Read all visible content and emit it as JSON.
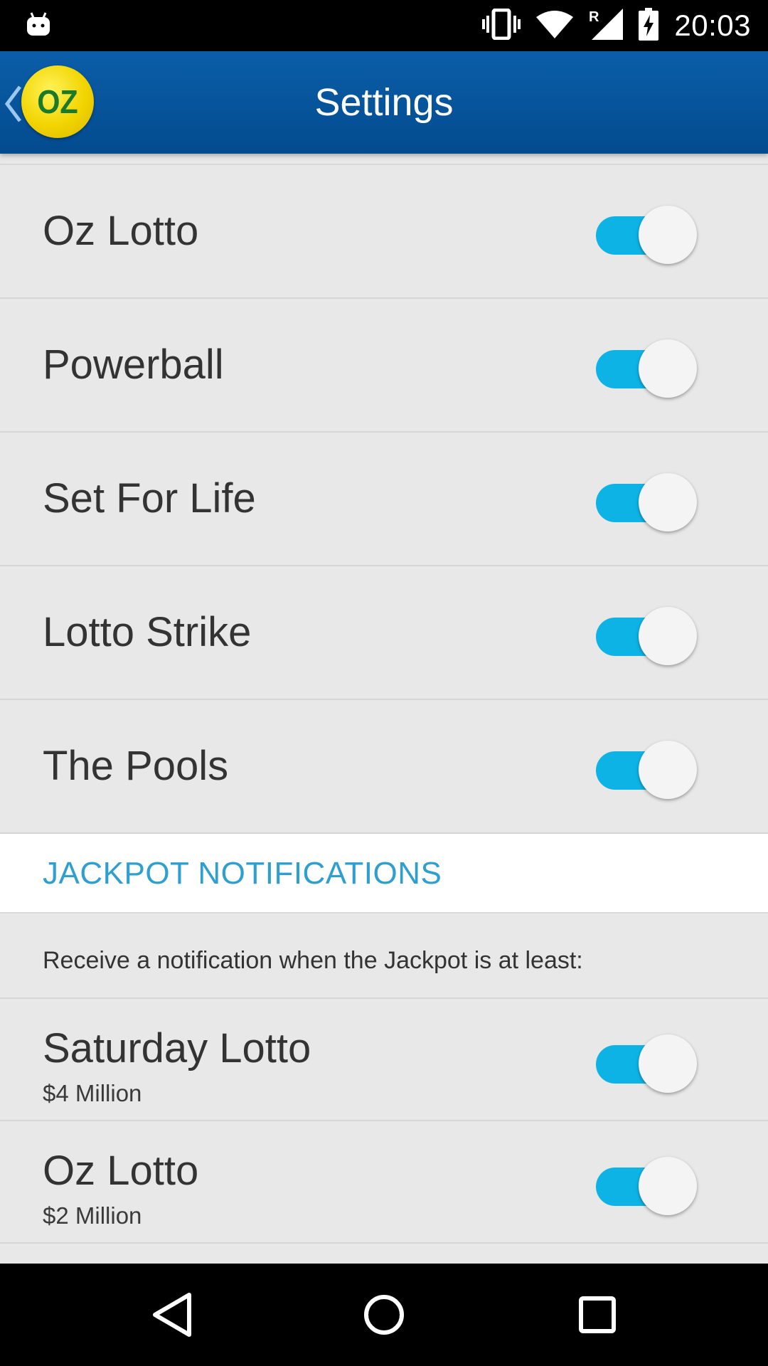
{
  "status_bar": {
    "time": "20:03",
    "notification_icon": "android-icon",
    "icons": [
      "vibrate-icon",
      "wifi-icon",
      "signal-roaming-icon",
      "battery-charging-icon"
    ]
  },
  "app_bar": {
    "logo_text": "OZ",
    "title": "Settings"
  },
  "game_toggles": [
    {
      "label": "Oz Lotto",
      "enabled": true
    },
    {
      "label": "Powerball",
      "enabled": true
    },
    {
      "label": "Set For Life",
      "enabled": true
    },
    {
      "label": "Lotto Strike",
      "enabled": true
    },
    {
      "label": "The Pools",
      "enabled": true
    }
  ],
  "jackpot_section": {
    "header": "JACKPOT NOTIFICATIONS",
    "description": "Receive a notification when the Jackpot is at least:",
    "items": [
      {
        "label": "Saturday Lotto",
        "amount": "$4 Million",
        "enabled": true
      },
      {
        "label": "Oz Lotto",
        "amount": "$2 Million",
        "enabled": true
      }
    ]
  },
  "colors": {
    "app_bar": "#0a5ea8",
    "toggle_on": "#0eb3e6",
    "section_header_text": "#2e9fcf",
    "logo": "#f2d400"
  },
  "nav_bar": {
    "icons": [
      "back-triangle-icon",
      "home-circle-icon",
      "recents-square-icon"
    ]
  }
}
